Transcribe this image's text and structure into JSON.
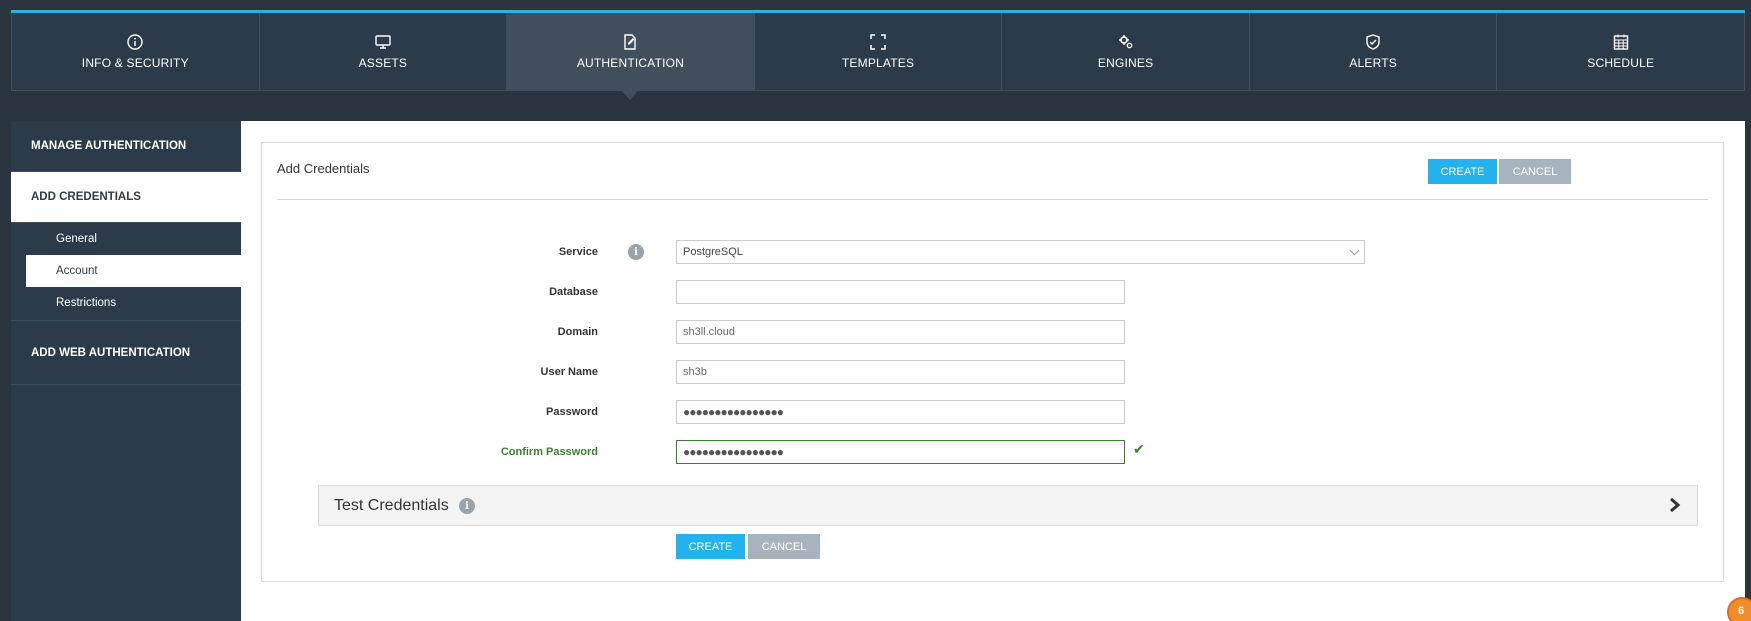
{
  "nav": {
    "tabs": [
      {
        "label": "INFO & SECURITY",
        "icon": "info-circle-icon"
      },
      {
        "label": "ASSETS",
        "icon": "monitor-icon"
      },
      {
        "label": "AUTHENTICATION",
        "icon": "edit-document-icon",
        "active": true
      },
      {
        "label": "TEMPLATES",
        "icon": "frame-brackets-icon"
      },
      {
        "label": "ENGINES",
        "icon": "gears-icon"
      },
      {
        "label": "ALERTS",
        "icon": "shield-check-icon"
      },
      {
        "label": "SCHEDULE",
        "icon": "calendar-icon"
      }
    ]
  },
  "sidebar": {
    "manage_auth": "MANAGE AUTHENTICATION",
    "add_credentials": "ADD CREDENTIALS",
    "sub_items": [
      {
        "label": "General"
      },
      {
        "label": "Account",
        "active": true
      },
      {
        "label": "Restrictions"
      }
    ],
    "add_web_auth": "ADD WEB AUTHENTICATION"
  },
  "panel": {
    "title": "Add Credentials",
    "create_label": "CREATE",
    "cancel_label": "CANCEL"
  },
  "form": {
    "service_label": "Service",
    "service_value": "PostgreSQL",
    "database_label": "Database",
    "database_value": "",
    "domain_label": "Domain",
    "domain_value": "sh3ll.cloud",
    "username_label": "User Name",
    "username_value": "sh3b",
    "password_label": "Password",
    "password_value": "●●●●●●●●●●●●●●●●",
    "confirm_label": "Confirm Password",
    "confirm_value": "●●●●●●●●●●●●●●●●"
  },
  "test_credentials": {
    "label": "Test Credentials"
  },
  "footer_buttons": {
    "create_label": "CREATE",
    "cancel_label": "CANCEL"
  },
  "notification_badge": "6",
  "colors": {
    "accent": "#22b2ee",
    "nav_bg": "#2c3b4a",
    "valid": "#3a7f2e",
    "badge": "#f28c28"
  }
}
